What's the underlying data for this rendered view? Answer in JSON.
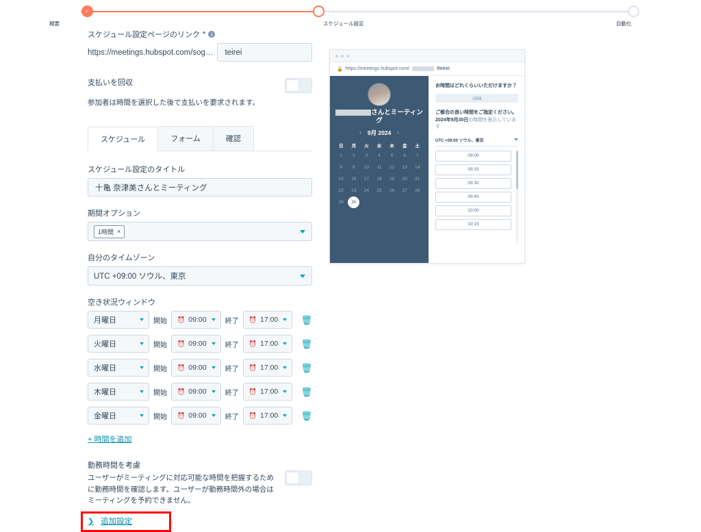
{
  "stepper": {
    "steps": [
      {
        "label": "概要",
        "state": "done"
      },
      {
        "label": "スケジュール設定",
        "state": "current"
      },
      {
        "label": "自動化",
        "state": "upcoming"
      }
    ],
    "accent_color": "#ff7a59",
    "line_color": "#dfe3eb"
  },
  "form": {
    "link_label": "スケジュール設定ページのリンク",
    "link_required_mark": "*",
    "info_icon_glyph": "i",
    "url_prefix": "https://meetings.hubspot.com/sog…",
    "slug_value": "teirei",
    "payment": {
      "title": "支払いを回収",
      "description": "参加者は時間を選択した後で支払いを要求されます。",
      "toggle_state": "off"
    },
    "tabs": [
      {
        "label": "スケジュール",
        "active": true
      },
      {
        "label": "フォーム",
        "active": false
      },
      {
        "label": "確認",
        "active": false
      }
    ],
    "title_field": {
      "label": "スケジュール設定のタイトル",
      "value": "十亀 奈津美さんとミーティング"
    },
    "duration": {
      "label": "期間オプション",
      "chip": "1時間",
      "chip_remove": "×"
    },
    "timezone": {
      "label": "自分のタイムゾーン",
      "value": "UTC +09:00 ソウル、東京"
    },
    "availability": {
      "label": "空き状況ウィンドウ",
      "start_label": "開始",
      "end_label": "終了",
      "clock_icon": "⏰",
      "delete_icon": "🗑",
      "rows": [
        {
          "day": "月曜日",
          "start": "09:00",
          "end": "17:00"
        },
        {
          "day": "火曜日",
          "start": "09:00",
          "end": "17:00"
        },
        {
          "day": "水曜日",
          "start": "09:00",
          "end": "17:00"
        },
        {
          "day": "木曜日",
          "start": "09:00",
          "end": "17:00"
        },
        {
          "day": "金曜日",
          "start": "09:00",
          "end": "17:00"
        }
      ],
      "add_label": "時間を追加",
      "add_icon": "+"
    },
    "working_hours": {
      "title": "勤務時間を考慮",
      "description": "ユーザーがミーティングに対応可能な時間を把握するために勤務時間を確認します。ユーザーが勤務時間外の場合はミーティングを予約できません。",
      "toggle_state": "off"
    },
    "more_settings": {
      "label": "追加設定",
      "chevron": "❯",
      "highlight_color": "#ff0000"
    }
  },
  "preview": {
    "browser": {
      "lock_icon": "🔒",
      "url_prefix": "https://meetings.hubspot.com/",
      "url_suffix": "/teirei"
    },
    "calendar": {
      "meeting_title_suffix": "さんとミーティング",
      "prev_arrow": "‹",
      "next_arrow": "›",
      "month_label": "9月 2024",
      "weekdays": [
        "日",
        "月",
        "火",
        "水",
        "木",
        "金",
        "土"
      ],
      "weeks": [
        [
          "1",
          "2",
          "3",
          "4",
          "5",
          "6",
          "7"
        ],
        [
          "8",
          "9",
          "10",
          "11",
          "12",
          "13",
          "14"
        ],
        [
          "15",
          "16",
          "17",
          "18",
          "19",
          "20",
          "21"
        ],
        [
          "22",
          "23",
          "24",
          "25",
          "26",
          "27",
          "28"
        ],
        [
          "29",
          "30",
          "",
          "",
          "",
          "",
          ""
        ]
      ],
      "selected_date": "30",
      "bg_color": "#3e5973"
    },
    "slots": {
      "question": "お時間はどれくらいいただけますか？",
      "duration_button": "1時間",
      "subtitle_bold": "ご都合の良い時間をご指定ください。",
      "subtitle_date": "2024年9月30日",
      "subtitle_rest": "の時間を表示しています",
      "timezone": "UTC +09:00 ソウル、東京",
      "times": [
        "09:00",
        "09:15",
        "09:30",
        "09:45",
        "10:00",
        "10:15"
      ]
    }
  }
}
